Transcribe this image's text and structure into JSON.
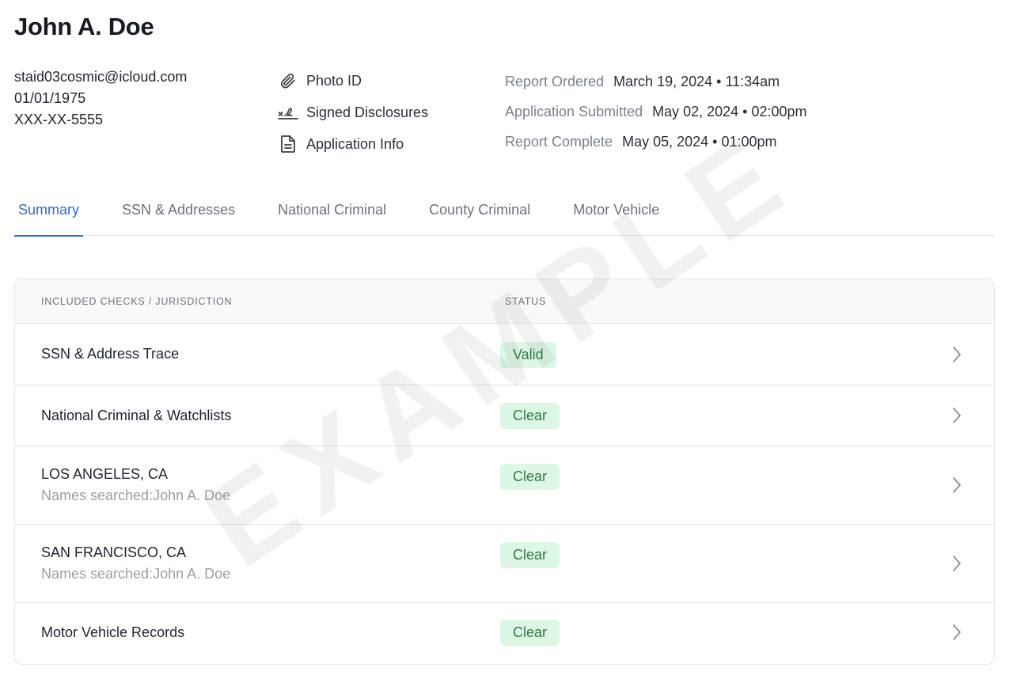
{
  "applicant": {
    "name": "John A. Doe",
    "email": "staid03cosmic@icloud.com",
    "dob": "01/01/1975",
    "ssn": "XXX-XX-5555"
  },
  "documents": [
    {
      "icon": "paperclip-icon",
      "label": "Photo ID"
    },
    {
      "icon": "signature-icon",
      "label": "Signed Disclosures"
    },
    {
      "icon": "document-icon",
      "label": "Application Info"
    }
  ],
  "dates": [
    {
      "label": "Report Ordered",
      "value": "March 19, 2024 • 11:34am"
    },
    {
      "label": "Application Submitted",
      "value": "May 02, 2024 • 02:00pm"
    },
    {
      "label": "Report Complete",
      "value": "May 05, 2024 • 01:00pm"
    }
  ],
  "tabs": [
    {
      "label": "Summary",
      "active": true
    },
    {
      "label": "SSN & Addresses",
      "active": false
    },
    {
      "label": "National Criminal",
      "active": false
    },
    {
      "label": "County Criminal",
      "active": false
    },
    {
      "label": "Motor Vehicle",
      "active": false
    }
  ],
  "table": {
    "headers": {
      "check": "INCLUDED CHECKS / JURISDICTION",
      "status": "STATUS"
    },
    "rows": [
      {
        "title": "SSN & Address Trace",
        "sub": "",
        "status": "Valid"
      },
      {
        "title": "National Criminal & Watchlists",
        "sub": "",
        "status": "Clear"
      },
      {
        "title": "LOS ANGELES, CA",
        "sub": "Names searched:John A. Doe",
        "status": "Clear"
      },
      {
        "title": "SAN FRANCISCO, CA",
        "sub": "Names searched:John A. Doe",
        "status": "Clear"
      },
      {
        "title": "Motor Vehicle Records",
        "sub": "",
        "status": "Clear"
      }
    ]
  },
  "watermark": "EXAMPLE",
  "colors": {
    "accent": "#3568d4",
    "badge_bg": "#dcf7e4",
    "badge_text": "#2e7a44"
  }
}
